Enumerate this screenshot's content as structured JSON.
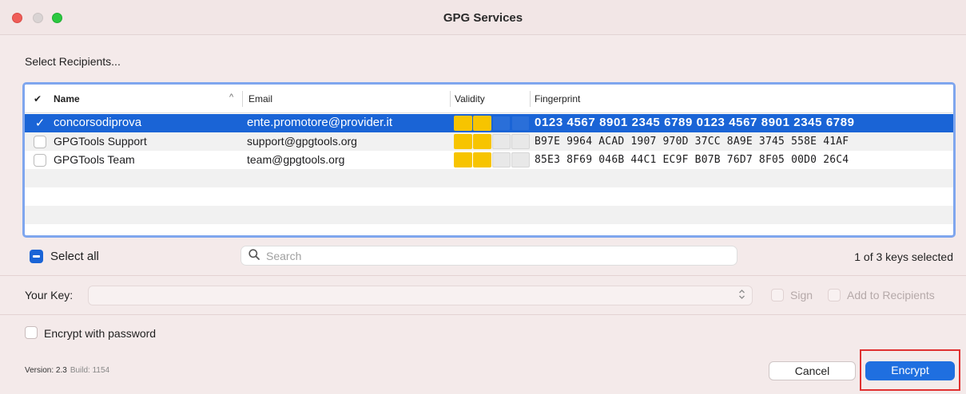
{
  "window": {
    "title": "GPG Services"
  },
  "recipients": {
    "heading": "Select Recipients...",
    "columns": {
      "check": "✔",
      "name": "Name",
      "email": "Email",
      "validity": "Validity",
      "fingerprint": "Fingerprint"
    },
    "rows": [
      {
        "checked": true,
        "name": "concorsodiprova",
        "email": "ente.promotore@provider.it",
        "validity_level": 2,
        "fingerprint": "0123 4567 8901 2345 6789  0123 4567 8901 2345 6789"
      },
      {
        "checked": false,
        "name": "GPGTools Support",
        "email": "support@gpgtools.org",
        "validity_level": 2,
        "fingerprint": "B97E 9964 ACAD 1907 970D  37CC 8A9E 3745 558E 41AF"
      },
      {
        "checked": false,
        "name": "GPGTools Team",
        "email": "team@gpgtools.org",
        "validity_level": 2,
        "fingerprint": "85E3 8F69 046B 44C1 EC9F  B07B 76D7 8F05 00D0 26C4"
      }
    ]
  },
  "select_all": {
    "label": "Select all"
  },
  "search": {
    "placeholder": "Search"
  },
  "key_count": "1 of 3 keys selected",
  "your_key": {
    "label": "Your Key:",
    "value": ""
  },
  "options": {
    "sign": "Sign",
    "add_to_recipients": "Add to Recipients",
    "encrypt_with_password": "Encrypt with password"
  },
  "version": {
    "version": "Version: 2.3",
    "build": "Build: 1154"
  },
  "buttons": {
    "cancel": "Cancel",
    "encrypt": "Encrypt"
  },
  "colors": {
    "selection": "#1a64d6",
    "validity": "#f7c400",
    "accent": "#1f6fe0",
    "highlight": "#e03030"
  }
}
